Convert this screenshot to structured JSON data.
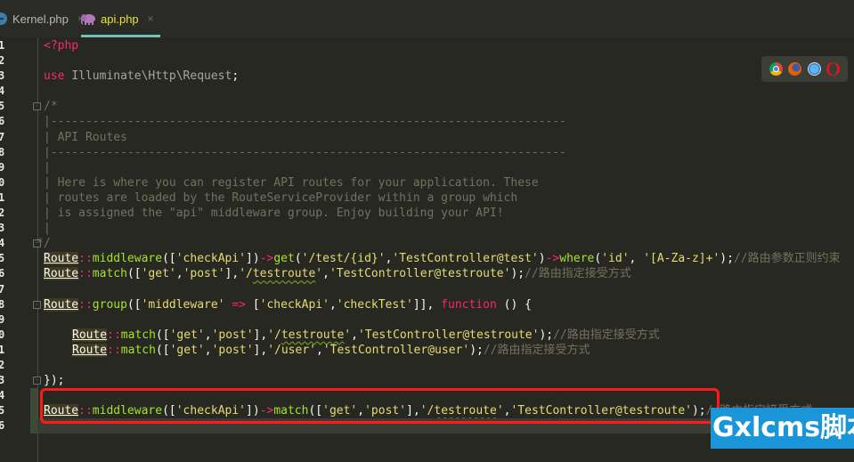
{
  "tabs": [
    {
      "label": "Kernel.php",
      "icon": "php-class-icon",
      "active": false
    },
    {
      "label": "api.php",
      "icon": "php-elephant-icon",
      "active": true
    }
  ],
  "tab_close_glyph": "×",
  "colors": {
    "editor_bg": "#272822",
    "active_tab_text": "#e6e33c",
    "active_tab_underline": "#6cc5b8",
    "highlight_box": "#ff1a1a",
    "watermark_bg": "#1a96d8"
  },
  "line_numbers": [
    "1",
    "2",
    "3",
    "4",
    "5",
    "6",
    "7",
    "8",
    "9",
    "0",
    "1",
    "2",
    "3",
    "4",
    "5",
    "6",
    "7",
    "8",
    "9",
    "0",
    "1",
    "2",
    "3",
    "4",
    "5",
    "6"
  ],
  "code": {
    "l1": "<?php",
    "l3_kw": "use",
    "l3_ns": "Illuminate\\Http\\Request",
    "l3_end": ";",
    "l5": "/*",
    "l6": "|--------------------------------------------------------------------------",
    "l7": "| API Routes",
    "l8": "|--------------------------------------------------------------------------",
    "l9": "|",
    "l10": "| Here is where you can register API routes for your application. These",
    "l11": "| routes are loaded by the RouteServiceProvider within a group which",
    "l12": "| is assigned the \"api\" middleware group. Enjoy building your API!",
    "l13": "|",
    "l14": "*/",
    "route": "Route",
    "dcolon": "::",
    "arrow": "->",
    "middleware": "middleware",
    "get": "get",
    "where": "where",
    "match": "match",
    "group": "group",
    "function": "function",
    "s_checkApi": "'checkApi'",
    "s_checkTest": "'checkTest'",
    "s_middleware": "'middleware'",
    "s_test_id": "'/test/{id}'",
    "s_ctrl_test": "'TestController@test'",
    "s_id": "'id'",
    "s_regex": "'[A-Za-z]+'",
    "s_get": "'get'",
    "s_post": "'post'",
    "s_testroute_q1": "'/",
    "s_testroute_word": "testroute",
    "s_testroute_q2": "'",
    "s_ctrl_testroute": "'TestController@testroute'",
    "s_user": "'/user'",
    "s_ctrl_user": "'TestController@user'",
    "fat_arrow": "=>",
    "c_regex": "//路由参数正则约束",
    "c_method": "//路由指定接受方式",
    "close_group": "});"
  },
  "browser_icons": [
    "chrome-icon",
    "firefox-icon",
    "safari-icon",
    "opera-icon"
  ],
  "watermark": "Gxlcms脚本"
}
